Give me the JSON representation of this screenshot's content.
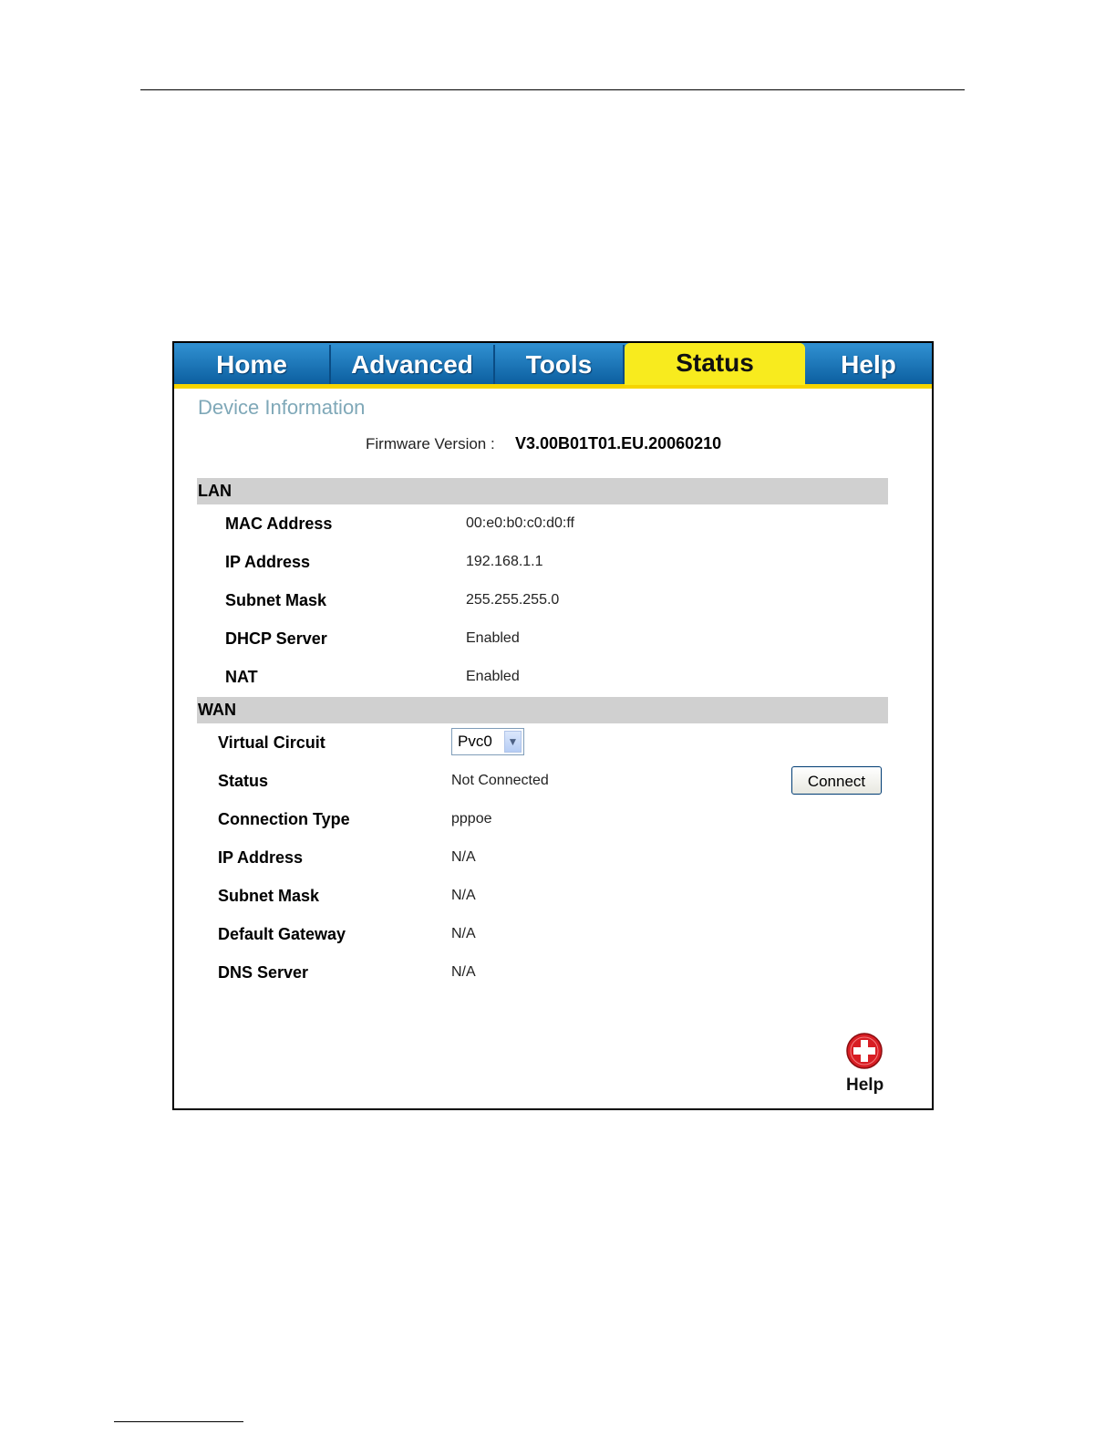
{
  "nav": {
    "tabs": [
      {
        "label": "Home"
      },
      {
        "label": "Advanced"
      },
      {
        "label": "Tools"
      },
      {
        "label": "Status",
        "active": true
      },
      {
        "label": "Help"
      }
    ]
  },
  "page": {
    "title": "Device Information",
    "firmware_label": "Firmware Version :",
    "firmware_value": "V3.00B01T01.EU.20060210"
  },
  "lan": {
    "heading": "LAN",
    "rows": [
      {
        "label": "MAC Address",
        "value": "00:e0:b0:c0:d0:ff"
      },
      {
        "label": "IP Address",
        "value": "192.168.1.1"
      },
      {
        "label": "Subnet Mask",
        "value": "255.255.255.0"
      },
      {
        "label": "DHCP Server",
        "value": "Enabled"
      },
      {
        "label": "NAT",
        "value": "Enabled"
      }
    ]
  },
  "wan": {
    "heading": "WAN",
    "virtual_circuit_label": "Virtual Circuit",
    "virtual_circuit_value": "Pvc0",
    "status_label": "Status",
    "status_value": "Not Connected",
    "connect_button": "Connect",
    "rows": [
      {
        "label": "Connection Type",
        "value": "pppoe"
      },
      {
        "label": "IP Address",
        "value": "N/A"
      },
      {
        "label": "Subnet Mask",
        "value": "N/A"
      },
      {
        "label": "Default Gateway",
        "value": "N/A"
      },
      {
        "label": "DNS Server",
        "value": "N/A"
      }
    ]
  },
  "help": {
    "label": "Help",
    "icon": "plus-circle-icon",
    "icon_color": "#d81e24"
  },
  "colors": {
    "tab_blue": "#1a74bb",
    "tab_active": "#f8eb1e",
    "section_bar": "#d0d0d0",
    "title": "#7fa8b8"
  }
}
